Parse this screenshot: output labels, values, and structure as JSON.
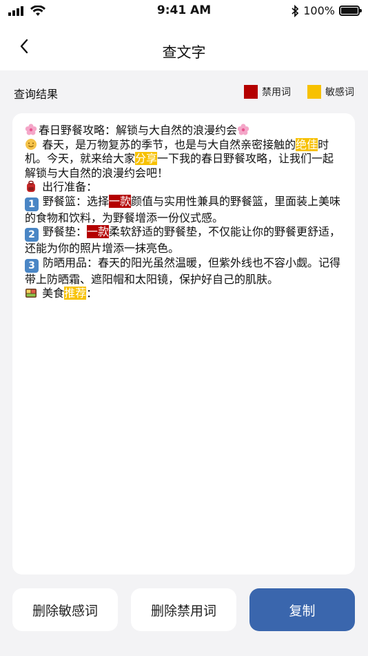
{
  "status_bar": {
    "time": "9:41 AM",
    "battery": "100%"
  },
  "nav": {
    "title": "查文字"
  },
  "result": {
    "label": "查询结果",
    "legend": {
      "banned": {
        "label": "禁用词",
        "color": "#b40000"
      },
      "sensitive": {
        "label": "敏感词",
        "color": "#f7c100"
      }
    }
  },
  "content": {
    "line1": {
      "text": "春日野餐攻略：解锁与大自然的浪漫约会"
    },
    "para2": {
      "a": " 春天，是万物复苏的季节，也是与大自然亲密接触的",
      "s1": "绝佳",
      "b": "时机。今天，就来给大家",
      "s2": "分享",
      "c": "一下我的春日野餐攻略，让我们一起解锁与大自然的浪漫约会吧！"
    },
    "prep": {
      "text": " 出行准备："
    },
    "item1": {
      "num": "1",
      "a": "野餐篮：选择",
      "banned": "一款",
      "b": "颜值与实用性兼具的野餐篮，里面装上美味的食物和饮料，为野餐增添一份仪式感。"
    },
    "item2": {
      "num": "2",
      "a": "野餐垫：",
      "banned": "一款",
      "b": "柔软舒适的野餐垫，不仅能让你的野餐更舒适，还能为你的照片增添一抹亮色。"
    },
    "item3": {
      "num": "3",
      "text": "防晒用品：春天的阳光虽然温暖，但紫外线也不容小觑。记得带上防晒霜、遮阳帽和太阳镜，保护好自己的肌肤。"
    },
    "food": {
      "a": " 美食",
      "s": "推荐",
      "b": "："
    }
  },
  "buttons": {
    "delete_sensitive": "删除敏感词",
    "delete_banned": "删除禁用词",
    "copy": "复制"
  }
}
